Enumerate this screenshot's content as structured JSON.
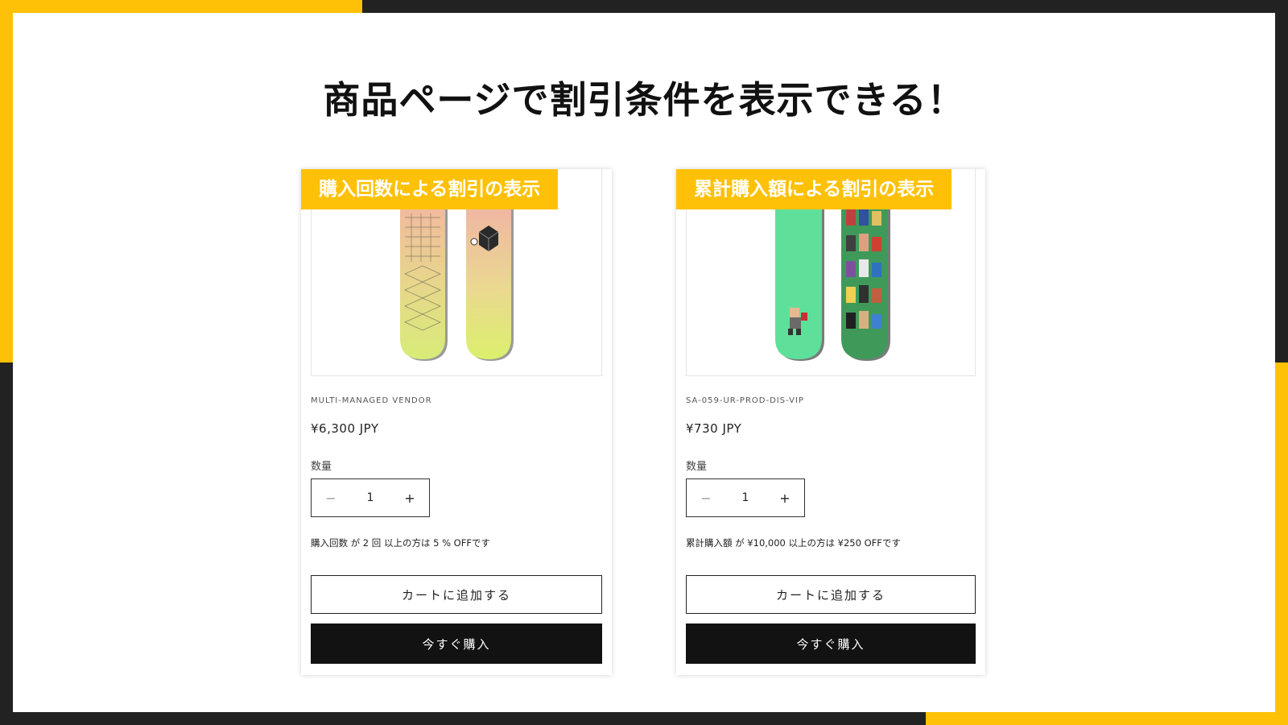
{
  "headline": "商品ページで割引条件を表示できる！",
  "colors": {
    "accent": "#FFC107",
    "frame_dark": "#222222",
    "button_dark": "#121212"
  },
  "cards": [
    {
      "tag": "購入回数による割引の表示",
      "vendor": "MULTI-MANAGED VENDOR",
      "price": "¥6,300 JPY",
      "quantity_label": "数量",
      "quantity_value": "1",
      "condition": "購入回数 が 2 回 以上の方は 5 % OFFです",
      "add_to_cart": "カートに追加する",
      "buy_now": "今すぐ購入",
      "product_image": "snowboard-pastel-gradient"
    },
    {
      "tag": "累計購入額による割引の表示",
      "vendor": "SA-059-UR-PROD-DIS-VIP",
      "price": "¥730 JPY",
      "quantity_label": "数量",
      "quantity_value": "1",
      "condition": "累計購入額 が ¥10,000 以上の方は ¥250 OFFです",
      "add_to_cart": "カートに追加する",
      "buy_now": "今すぐ購入",
      "product_image": "snowboard-green-pixel-characters"
    }
  ],
  "icons": {
    "minus": "minus-icon",
    "plus": "plus-icon"
  },
  "glyphs": {
    "minus": "−",
    "plus": "+"
  }
}
